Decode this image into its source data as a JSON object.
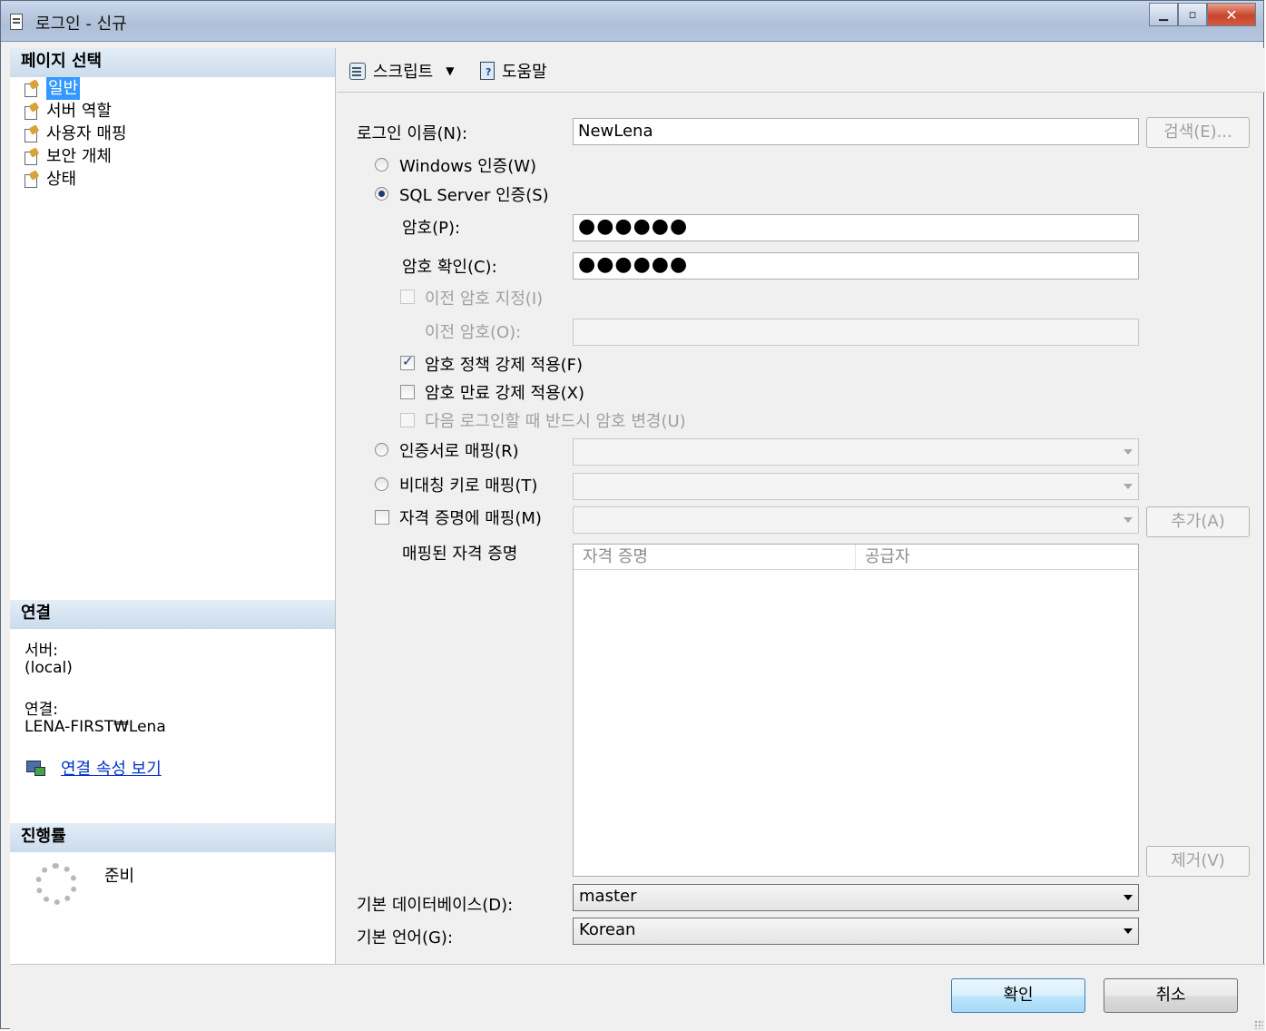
{
  "window": {
    "title": "로그인 - 신규"
  },
  "sidebar": {
    "page_select_header": "페이지 선택",
    "pages": [
      {
        "label": "일반"
      },
      {
        "label": "서버 역할"
      },
      {
        "label": "사용자 매핑"
      },
      {
        "label": "보안 개체"
      },
      {
        "label": "상태"
      }
    ],
    "selected_index": 0,
    "connection": {
      "header": "연결",
      "server_label": "서버:",
      "server_value": "(local)",
      "conn_label": "연결:",
      "conn_value": "LENA-FIRST₩Lena",
      "view_props_link": "연결 속성 보기"
    },
    "progress": {
      "header": "진행률",
      "status": "준비"
    }
  },
  "toolbar": {
    "script_label": "스크립트",
    "help_label": "도움말"
  },
  "form": {
    "login_name_label": "로그인 이름(N):",
    "login_name_value": "NewLena",
    "search_button": "검색(E)...",
    "windows_auth_label": "Windows 인증(W)",
    "sql_auth_label": "SQL Server 인증(S)",
    "auth_selected": "sql",
    "password_label": "암호(P):",
    "password_value": "●●●●●●",
    "confirm_label": "암호 확인(C):",
    "confirm_value": "●●●●●●",
    "specify_old_label": "이전 암호 지정(I)",
    "old_password_label": "이전 암호(O):",
    "enforce_policy_label": "암호 정책 강제 적용(F)",
    "enforce_policy_checked": true,
    "enforce_expiration_label": "암호 만료 강제 적용(X)",
    "enforce_expiration_checked": false,
    "must_change_label": "다음 로그인할 때 반드시 암호 변경(U)",
    "cert_mapping_label": "인증서로 매핑(R)",
    "asym_key_mapping_label": "비대칭 키로 매핑(T)",
    "credential_mapping_label": "자격 증명에 매핑(M)",
    "add_button": "추가(A)",
    "mapped_credentials_label": "매핑된 자격 증명",
    "columns": [
      "자격 증명",
      "공급자"
    ],
    "remove_button": "제거(V)",
    "default_db_label": "기본 데이터베이스(D):",
    "default_db_value": "master",
    "default_lang_label": "기본 언어(G):",
    "default_lang_value": "Korean"
  },
  "footer": {
    "ok_button": "확인",
    "cancel_button": "취소"
  }
}
